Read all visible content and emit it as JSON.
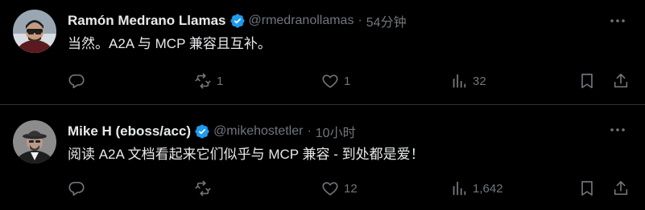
{
  "tweets": [
    {
      "name": "Ramón Medrano Llamas",
      "handle": "@rmedranollamas",
      "separator": "·",
      "time": "54分钟",
      "text": "当然。A2A 与 MCP 兼容且互补。",
      "reply_count": "",
      "retweet_count": "1",
      "like_count": "1",
      "view_count": "32"
    },
    {
      "name": "Mike H (eboss/acc)",
      "handle": "@mikehostetler",
      "separator": "·",
      "time": "10小时",
      "text": "阅读 A2A 文档看起来它们似乎与 MCP 兼容 - 到处都是爱！",
      "reply_count": "",
      "retweet_count": "",
      "like_count": "12",
      "view_count": "1,642"
    }
  ],
  "colors": {
    "background": "#000000",
    "text_primary": "#e7e9ea",
    "text_secondary": "#71767b",
    "verified_badge": "#1d9bf0",
    "divider": "#2f3336"
  },
  "icons": [
    "verified-badge-icon",
    "more-icon",
    "reply-icon",
    "retweet-icon",
    "like-icon",
    "views-icon",
    "bookmark-icon",
    "share-icon"
  ]
}
